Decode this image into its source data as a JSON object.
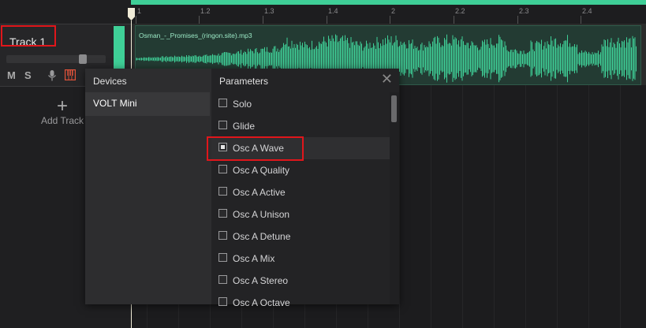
{
  "track": {
    "name": "Track 1",
    "mute_label": "M",
    "solo_label": "S",
    "color": "#3fcf97",
    "volume_fraction": 0.8
  },
  "add_track": {
    "label": "Add Track",
    "icon": "plus-icon"
  },
  "timeline": {
    "ruler_labels": [
      "1",
      "1.2",
      "1.3",
      "1.4",
      "2",
      "2.2",
      "2.3",
      "2.4"
    ],
    "clip_name": "Osman_-_Promises_(ringon.site).mp3"
  },
  "dialog": {
    "devices_title": "Devices",
    "parameters_title": "Parameters",
    "close_icon": "close-icon",
    "devices": [
      {
        "label": "VOLT Mini",
        "selected": true
      }
    ],
    "parameters": [
      {
        "label": "Solo",
        "checked": false
      },
      {
        "label": "Glide",
        "checked": false
      },
      {
        "label": "Osc A Wave",
        "checked": true
      },
      {
        "label": "Osc A Quality",
        "checked": false
      },
      {
        "label": "Osc A Active",
        "checked": false
      },
      {
        "label": "Osc A Unison",
        "checked": false
      },
      {
        "label": "Osc A Detune",
        "checked": false
      },
      {
        "label": "Osc A Mix",
        "checked": false
      },
      {
        "label": "Osc A Stereo",
        "checked": false
      },
      {
        "label": "Osc A Octave",
        "checked": false
      }
    ]
  },
  "colors": {
    "accent": "#3fcf97",
    "highlight": "#e0161b",
    "record": "#e0533a"
  }
}
